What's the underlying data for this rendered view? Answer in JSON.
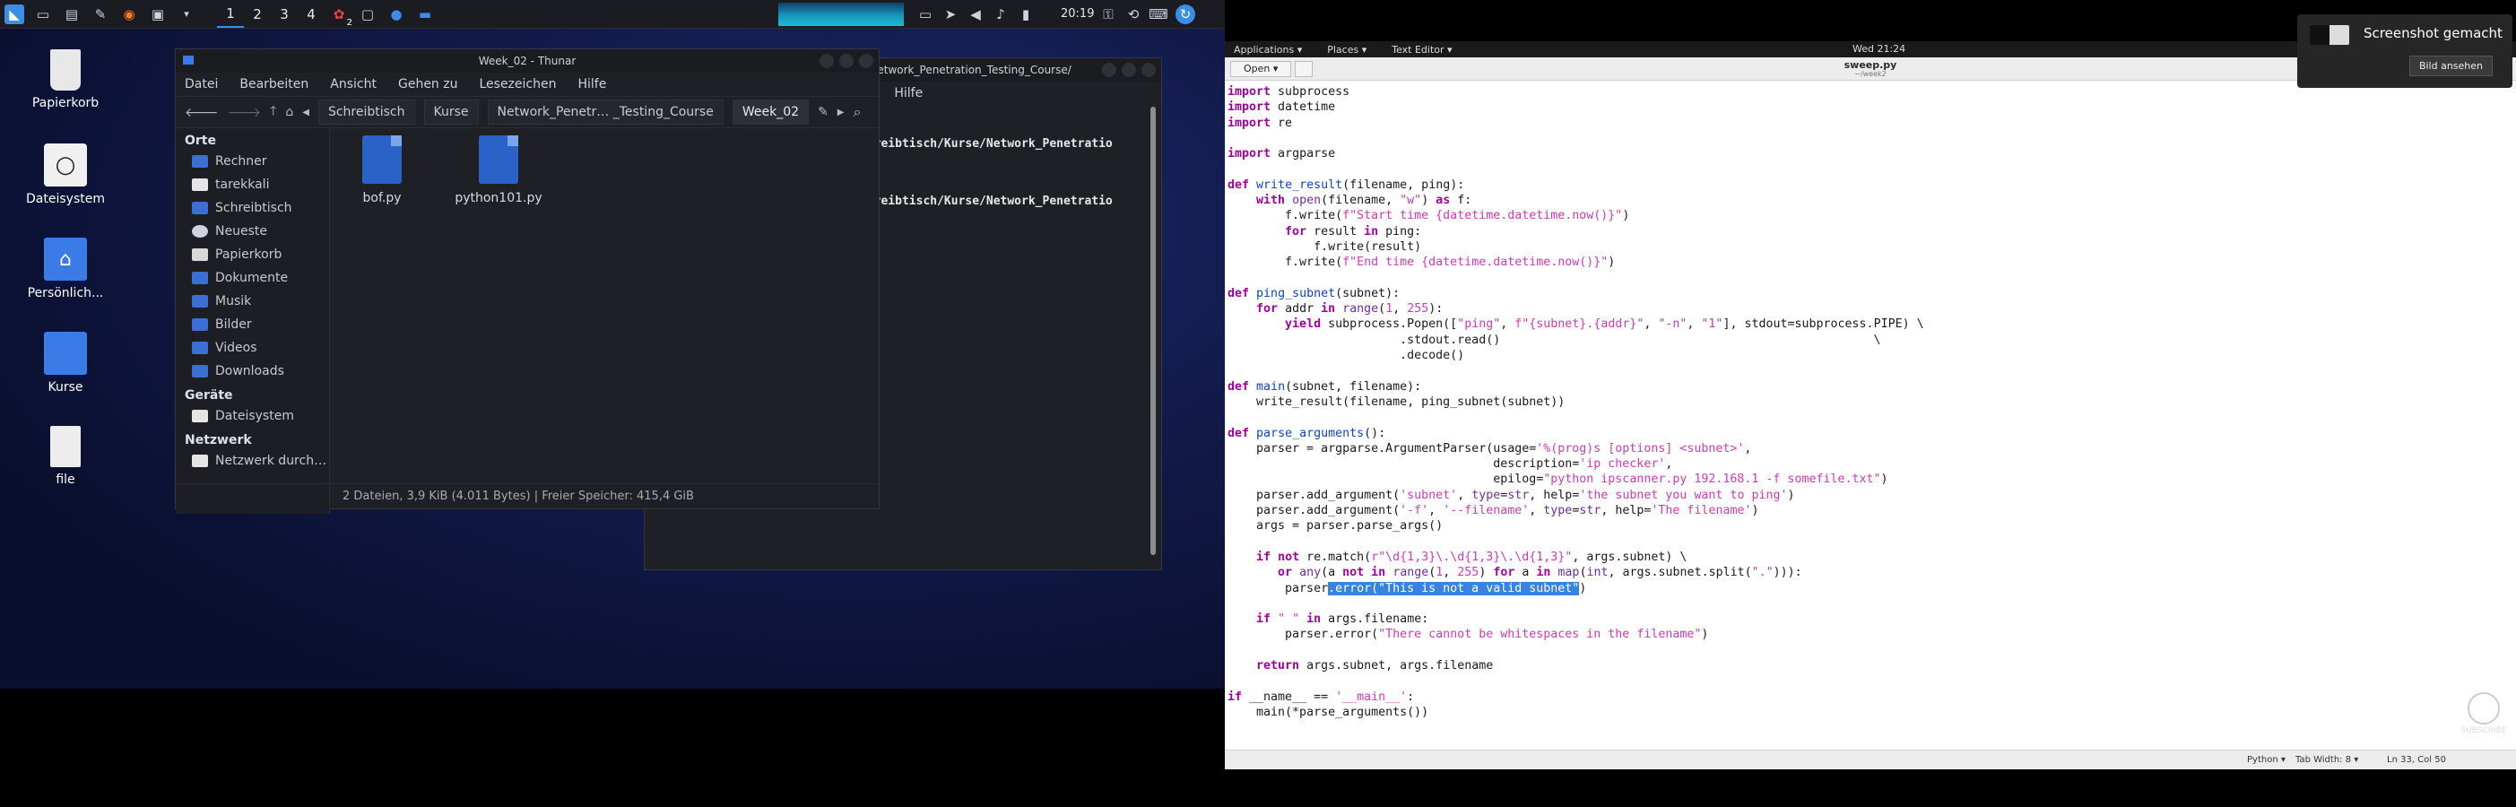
{
  "colors": {
    "accent": "#3584e4",
    "desktop_bg": "#121a4a",
    "keyword": "#a4009f",
    "string": "#d23ab8"
  },
  "left_panel": {
    "workspaces": [
      "1",
      "2",
      "3",
      "4"
    ],
    "notification_count": "2",
    "clock": "20:19",
    "icons": [
      "kali-menu-icon",
      "workspace-switcher-icon",
      "file-manager-icon",
      "text-editor-icon",
      "firefox-icon",
      "terminal-icon",
      "dropdown-icon",
      "notification-icon",
      "terminal-small-icon",
      "screenshot-icon",
      "folder-icon",
      "cpu-graph",
      "display-icon",
      "telegram-icon",
      "volume-icon",
      "bell-icon",
      "battery-icon",
      "lock-icon",
      "logout-icon",
      "keyboard-icon",
      "update-icon"
    ]
  },
  "desktop": {
    "icons": [
      {
        "label": "Papierkorb"
      },
      {
        "label": "Dateisystem"
      },
      {
        "label": "Persönlich..."
      },
      {
        "label": "Kurse"
      },
      {
        "label": "file"
      }
    ]
  },
  "thunar": {
    "title": "Week_02 - Thunar",
    "menu": [
      "Datei",
      "Bearbeiten",
      "Ansicht",
      "Gehen zu",
      "Lesezeichen",
      "Hilfe"
    ],
    "breadcrumbs": [
      "Schreibtisch",
      "Kurse",
      "Network_Penetr… _Testing_Course",
      "Week_02"
    ],
    "sidebar": {
      "sections": [
        {
          "title": "Orte",
          "items": [
            "Rechner",
            "tarekkali",
            "Schreibtisch",
            "Neueste",
            "Papierkorb",
            "Dokumente",
            "Musik",
            "Bilder",
            "Videos",
            "Downloads"
          ]
        },
        {
          "title": "Geräte",
          "items": [
            "Dateisystem"
          ]
        },
        {
          "title": "Netzwerk",
          "items": [
            "Netzwerk durch…"
          ]
        }
      ]
    },
    "files": [
      {
        "name": "bof.py"
      },
      {
        "name": "python101.py"
      }
    ],
    "status": "2 Dateien, 3,9 KiB (4.011 Bytes) | Freier Speicher: 415,4 GiB"
  },
  "terminal": {
    "title": "urse/Network_Penetration_Testing_Course/",
    "menu_visible": [
      "nt",
      "Hilfe"
    ],
    "lines": [
      "chreibtisch/Kurse/Network_Penetratio",
      "chreibtisch/Kurse/Network_Penetratio"
    ]
  },
  "gnome": {
    "menus": [
      "Applications ▾",
      "Places ▾",
      "Text Editor ▾"
    ],
    "clock": "Wed 21:24"
  },
  "editor": {
    "open_label": "Open ▾",
    "filename": "sweep.py",
    "path": "~/week2",
    "status": {
      "language": "Python ▾",
      "tab_width": "Tab Width: 8 ▾",
      "position": "Ln 33, Col 50"
    }
  },
  "notification": {
    "title": "Screenshot gemacht",
    "button": "Bild ansehen"
  },
  "subscribe": "SUBSCRIBE"
}
